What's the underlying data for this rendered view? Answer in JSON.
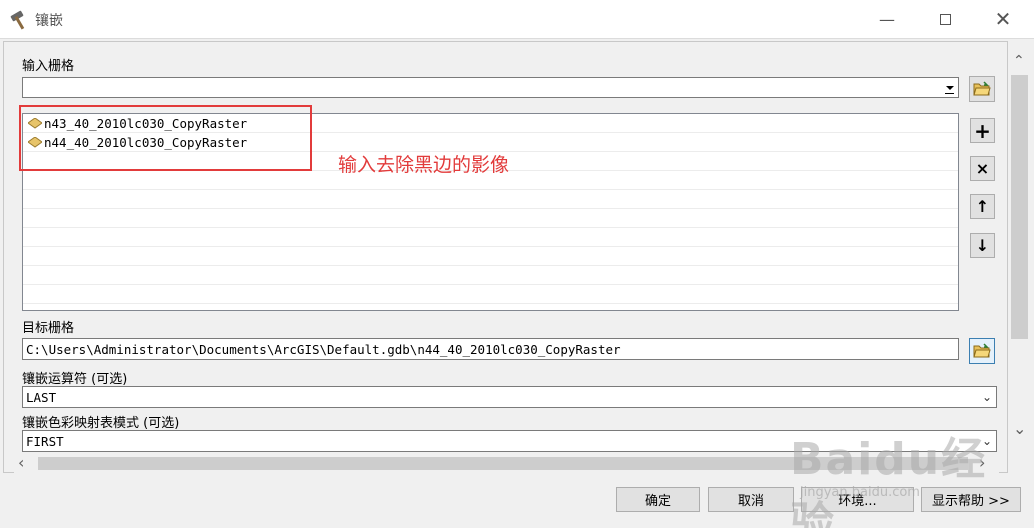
{
  "window": {
    "title": "镶嵌",
    "minimize_icon": "minimize-icon",
    "maximize_icon": "maximize-icon",
    "close_icon": "close-icon"
  },
  "input_rasters": {
    "label": "输入栅格",
    "combo_value": "",
    "items": [
      "n43_40_2010lc030_CopyRaster",
      "n44_40_2010lc030_CopyRaster"
    ]
  },
  "side_buttons": {
    "add": "+",
    "remove": "×",
    "up": "↑",
    "down": "↓"
  },
  "annotation": {
    "text": "输入去除黑边的影像",
    "color": "#e23b3b"
  },
  "target_raster": {
    "label": "目标栅格",
    "value": "C:\\Users\\Administrator\\Documents\\ArcGIS\\Default.gdb\\n44_40_2010lc030_CopyRaster"
  },
  "mosaic_operator": {
    "label": "镶嵌运算符 (可选)",
    "value": "LAST"
  },
  "colormap_mode": {
    "label": "镶嵌色彩映射表模式 (可选)",
    "value": "FIRST"
  },
  "buttons": {
    "ok": "确定",
    "cancel": "取消",
    "env": "环境...",
    "help": "显示帮助 >>"
  },
  "watermark": {
    "big": "Baidu经验",
    "small": "jingyan.baidu.com"
  }
}
